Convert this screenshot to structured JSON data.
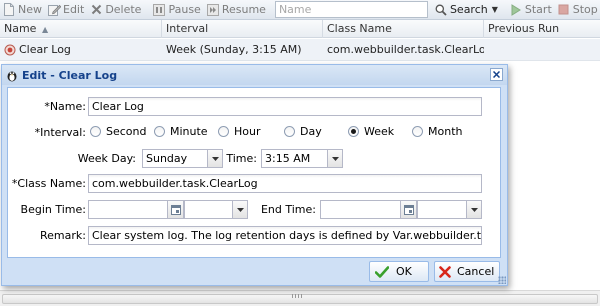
{
  "toolbar": {
    "new_label": "New",
    "edit_label": "Edit",
    "delete_label": "Delete",
    "pause_label": "Pause",
    "resume_label": "Resume",
    "name_placeholder": "Name",
    "search_label": "Search",
    "start_label": "Start",
    "stop_label": "Stop"
  },
  "grid": {
    "columns": [
      "Name",
      "Interval",
      "Class Name",
      "Previous Run"
    ],
    "sort_column": "Name",
    "rows": [
      {
        "name": "Clear Log",
        "interval": "Week (Sunday, 3:15 AM)",
        "class_name": "com.webbuilder.task.ClearLog",
        "previous_run": ""
      }
    ]
  },
  "dialog": {
    "title": "Edit - Clear Log",
    "fields": {
      "name_label": "*Name:",
      "name_value": "Clear Log",
      "interval_label": "*Interval:",
      "interval_options": [
        "Second",
        "Minute",
        "Hour",
        "Day",
        "Week",
        "Month"
      ],
      "interval_selected": "Week",
      "weekday_label": "Week Day:",
      "weekday_value": "Sunday",
      "time_label": "Time:",
      "time_value": "3:15 AM",
      "classname_label": "*Class Name:",
      "classname_value": "com.webbuilder.task.ClearLog",
      "begin_time_label": "Begin Time:",
      "begin_date_value": "",
      "begin_time_value": "",
      "end_time_label": "End Time:",
      "end_date_value": "",
      "end_time_value": "",
      "remark_label": "Remark:",
      "remark_value": "Clear system log. The log retention days is defined by Var.webbuilder.task.logDays."
    },
    "ok_label": "OK",
    "cancel_label": "Cancel"
  },
  "colors": {
    "accent": "#15428b",
    "dialog_border": "#99bbe8",
    "dialog_frame": "#cfe0f5",
    "row_selected": "#eef2f7",
    "ok_check": "#3aa02c",
    "cancel_x": "#d8261a"
  }
}
